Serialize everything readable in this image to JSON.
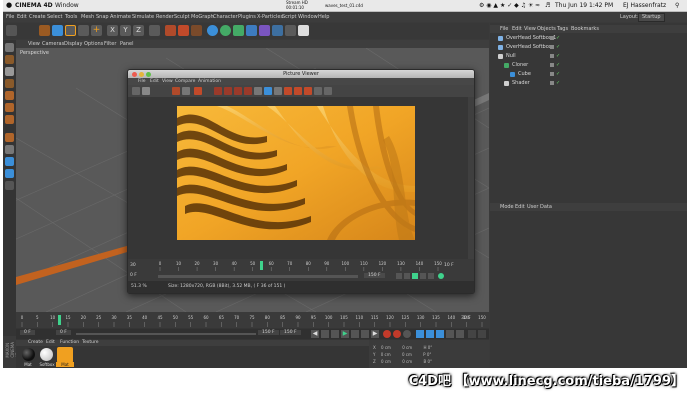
{
  "mac_menubar": {
    "app_name": "CINEMA 4D",
    "window_menu": "Window",
    "tray_top": "Stream HD",
    "tray_bottom": "00:01:10",
    "clock": "Thu Jun 19  1:42 PM",
    "user": "EJ Hassenfratz"
  },
  "title_file": "waves_test_01.c4d",
  "app_menu": [
    "File",
    "Edit",
    "Create",
    "Select",
    "Tools",
    "Mesh",
    "Snap",
    "Animate",
    "Simulate",
    "Render",
    "Sculpt",
    "MoGraph",
    "Character",
    "Plugins",
    "X-Particles",
    "Script",
    "Window",
    "Help"
  ],
  "layout": {
    "label": "Layout:",
    "value": "Startup"
  },
  "viewport": {
    "menu": [
      "View",
      "Cameras",
      "Display",
      "Options",
      "Filter",
      "Panel"
    ],
    "camera_label": "Perspective"
  },
  "object_manager": {
    "menu": [
      "File",
      "Edit",
      "View",
      "Objects",
      "Tags",
      "Bookmarks"
    ],
    "objects": [
      {
        "name": "OverHead Softbox 1",
        "indent": 0
      },
      {
        "name": "OverHead Softbox",
        "indent": 0
      },
      {
        "name": "Null",
        "indent": 0
      },
      {
        "name": "Cloner",
        "indent": 1
      },
      {
        "name": "Cube",
        "indent": 2
      },
      {
        "name": "Shader",
        "indent": 1
      }
    ]
  },
  "attributes": {
    "menu": [
      "Mode",
      "Edit",
      "User Data"
    ]
  },
  "picture_viewer": {
    "title": "Picture Viewer",
    "menu": [
      "File",
      "Edit",
      "View",
      "Compare",
      "Animation"
    ],
    "ruler_ticks": [
      "0",
      "10",
      "20",
      "30",
      "40",
      "50",
      "60",
      "70",
      "80",
      "90",
      "100",
      "110",
      "120",
      "130",
      "140",
      "150"
    ],
    "ruler_start": "30",
    "ruler_end": "10 F",
    "frame_start": "0 F",
    "frame_end": "150 F",
    "zoom": "51.3 %",
    "status": "Size: 1280x720, RGB (8Bit), 3.52 MB,   ( F 36 of 151 )"
  },
  "timeline": {
    "ticks": [
      "0",
      "5",
      "10",
      "15",
      "20",
      "25",
      "30",
      "35",
      "40",
      "45",
      "50",
      "55",
      "60",
      "65",
      "70",
      "75",
      "80",
      "85",
      "90",
      "95",
      "100",
      "105",
      "110",
      "115",
      "120",
      "125",
      "130",
      "135",
      "140",
      "145",
      "150"
    ],
    "start_field": "0 F",
    "mid_field": "0 F",
    "end_field": "150 F",
    "end_field2": "150 F",
    "fps_field": "30 F"
  },
  "material_manager": {
    "menu": [
      "Create",
      "Edit",
      "Function",
      "Texture"
    ],
    "materials": [
      {
        "name": "Mat",
        "color": "#101010"
      },
      {
        "name": "Softbox",
        "color": "#f2f2f2"
      },
      {
        "name": "Mat",
        "color": "#f0a020"
      }
    ]
  },
  "coordinates": {
    "rows": [
      {
        "axis": "X",
        "pos": "0 cm",
        "size": "0 cm",
        "rot": "H 0°"
      },
      {
        "axis": "Y",
        "pos": "0 cm",
        "size": "0 cm",
        "rot": "P 0°"
      },
      {
        "axis": "Z",
        "pos": "0 cm",
        "size": "0 cm",
        "rot": "B 0°"
      }
    ]
  },
  "side_label": "MAXON CINEMA 4D",
  "watermark": "C4D吧  【www.linecg.com/tieba/1799】",
  "colors": {
    "accent_blue": "#3b8fd9",
    "timeline_green": "#3fd28c",
    "render_orange": "#f0a020"
  }
}
